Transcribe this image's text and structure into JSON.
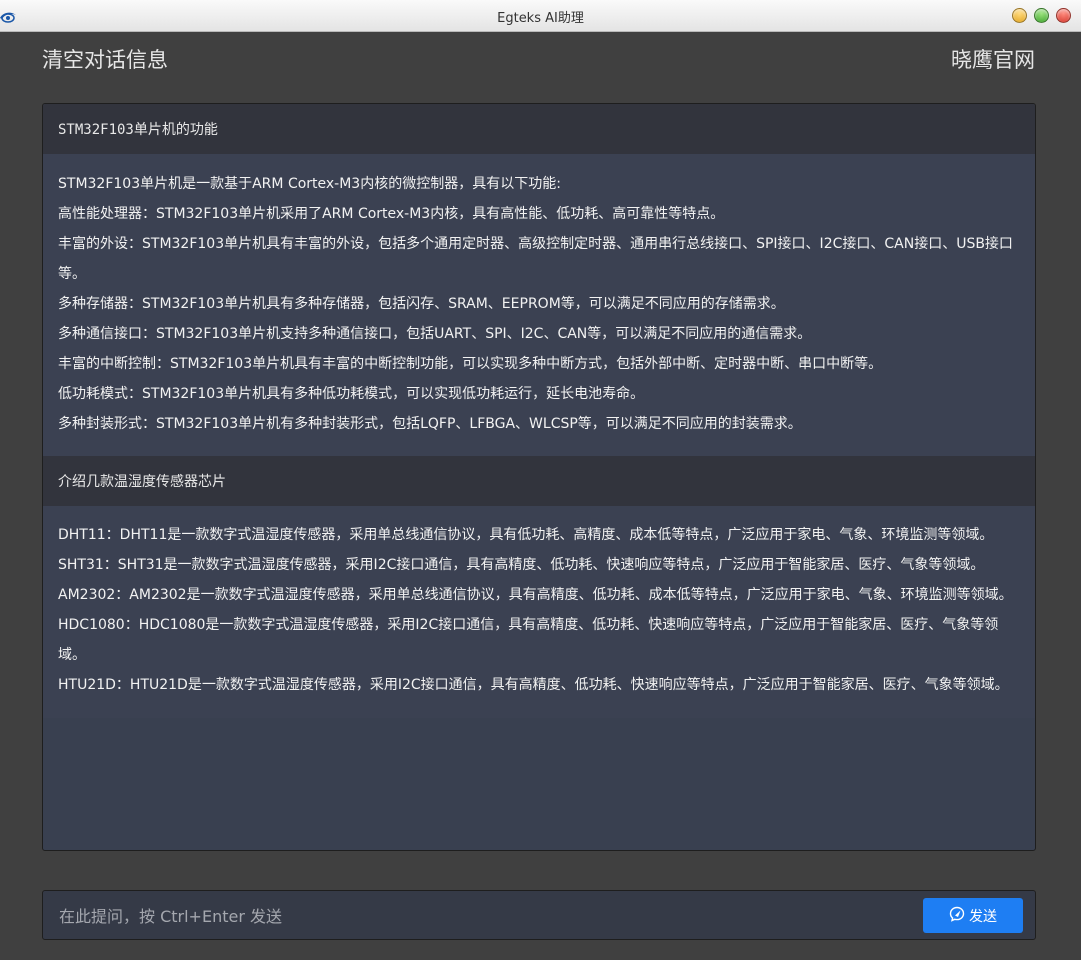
{
  "window": {
    "title": "Egteks AI助理",
    "icon": "eye-logo-icon"
  },
  "header": {
    "clear_label": "清空对话信息",
    "site_label": "晓鹰官网"
  },
  "conversation": [
    {
      "question": "STM32F103单片机的功能",
      "answer": [
        "STM32F103单片机是一款基于ARM Cortex-M3内核的微控制器，具有以下功能:",
        "高性能处理器：STM32F103单片机采用了ARM Cortex-M3内核，具有高性能、低功耗、高可靠性等特点。",
        "丰富的外设：STM32F103单片机具有丰富的外设，包括多个通用定时器、高级控制定时器、通用串行总线接口、SPI接口、I2C接口、CAN接口、USB接口等。",
        "多种存储器：STM32F103单片机具有多种存储器，包括闪存、SRAM、EEPROM等，可以满足不同应用的存储需求。",
        "多种通信接口：STM32F103单片机支持多种通信接口，包括UART、SPI、I2C、CAN等，可以满足不同应用的通信需求。",
        "丰富的中断控制：STM32F103单片机具有丰富的中断控制功能，可以实现多种中断方式，包括外部中断、定时器中断、串口中断等。",
        "低功耗模式：STM32F103单片机具有多种低功耗模式，可以实现低功耗运行，延长电池寿命。",
        "多种封装形式：STM32F103单片机有多种封装形式，包括LQFP、LFBGA、WLCSP等，可以满足不同应用的封装需求。"
      ]
    },
    {
      "question": "介绍几款温湿度传感器芯片",
      "answer": [
        "DHT11：DHT11是一款数字式温湿度传感器，采用单总线通信协议，具有低功耗、高精度、成本低等特点，广泛应用于家电、气象、环境监测等领域。",
        "SHT31：SHT31是一款数字式温湿度传感器，采用I2C接口通信，具有高精度、低功耗、快速响应等特点，广泛应用于智能家居、医疗、气象等领域。",
        "AM2302：AM2302是一款数字式温湿度传感器，采用单总线通信协议，具有高精度、低功耗、成本低等特点，广泛应用于家电、气象、环境监测等领域。",
        "HDC1080：HDC1080是一款数字式温湿度传感器，采用I2C接口通信，具有高精度、低功耗、快速响应等特点，广泛应用于智能家居、医疗、气象等领域。",
        "HTU21D：HTU21D是一款数字式温湿度传感器，采用I2C接口通信，具有高精度、低功耗、快速响应等特点，广泛应用于智能家居、医疗、气象等领域。"
      ]
    }
  ],
  "input": {
    "value": "",
    "placeholder": "在此提问，按 Ctrl+Enter 发送"
  },
  "send": {
    "label": "发送",
    "icon": "send-chat-icon"
  },
  "colors": {
    "background": "#404040",
    "question_bg": "#32343d",
    "answer_bg": "#3b4152",
    "accent": "#1e7ef3"
  }
}
